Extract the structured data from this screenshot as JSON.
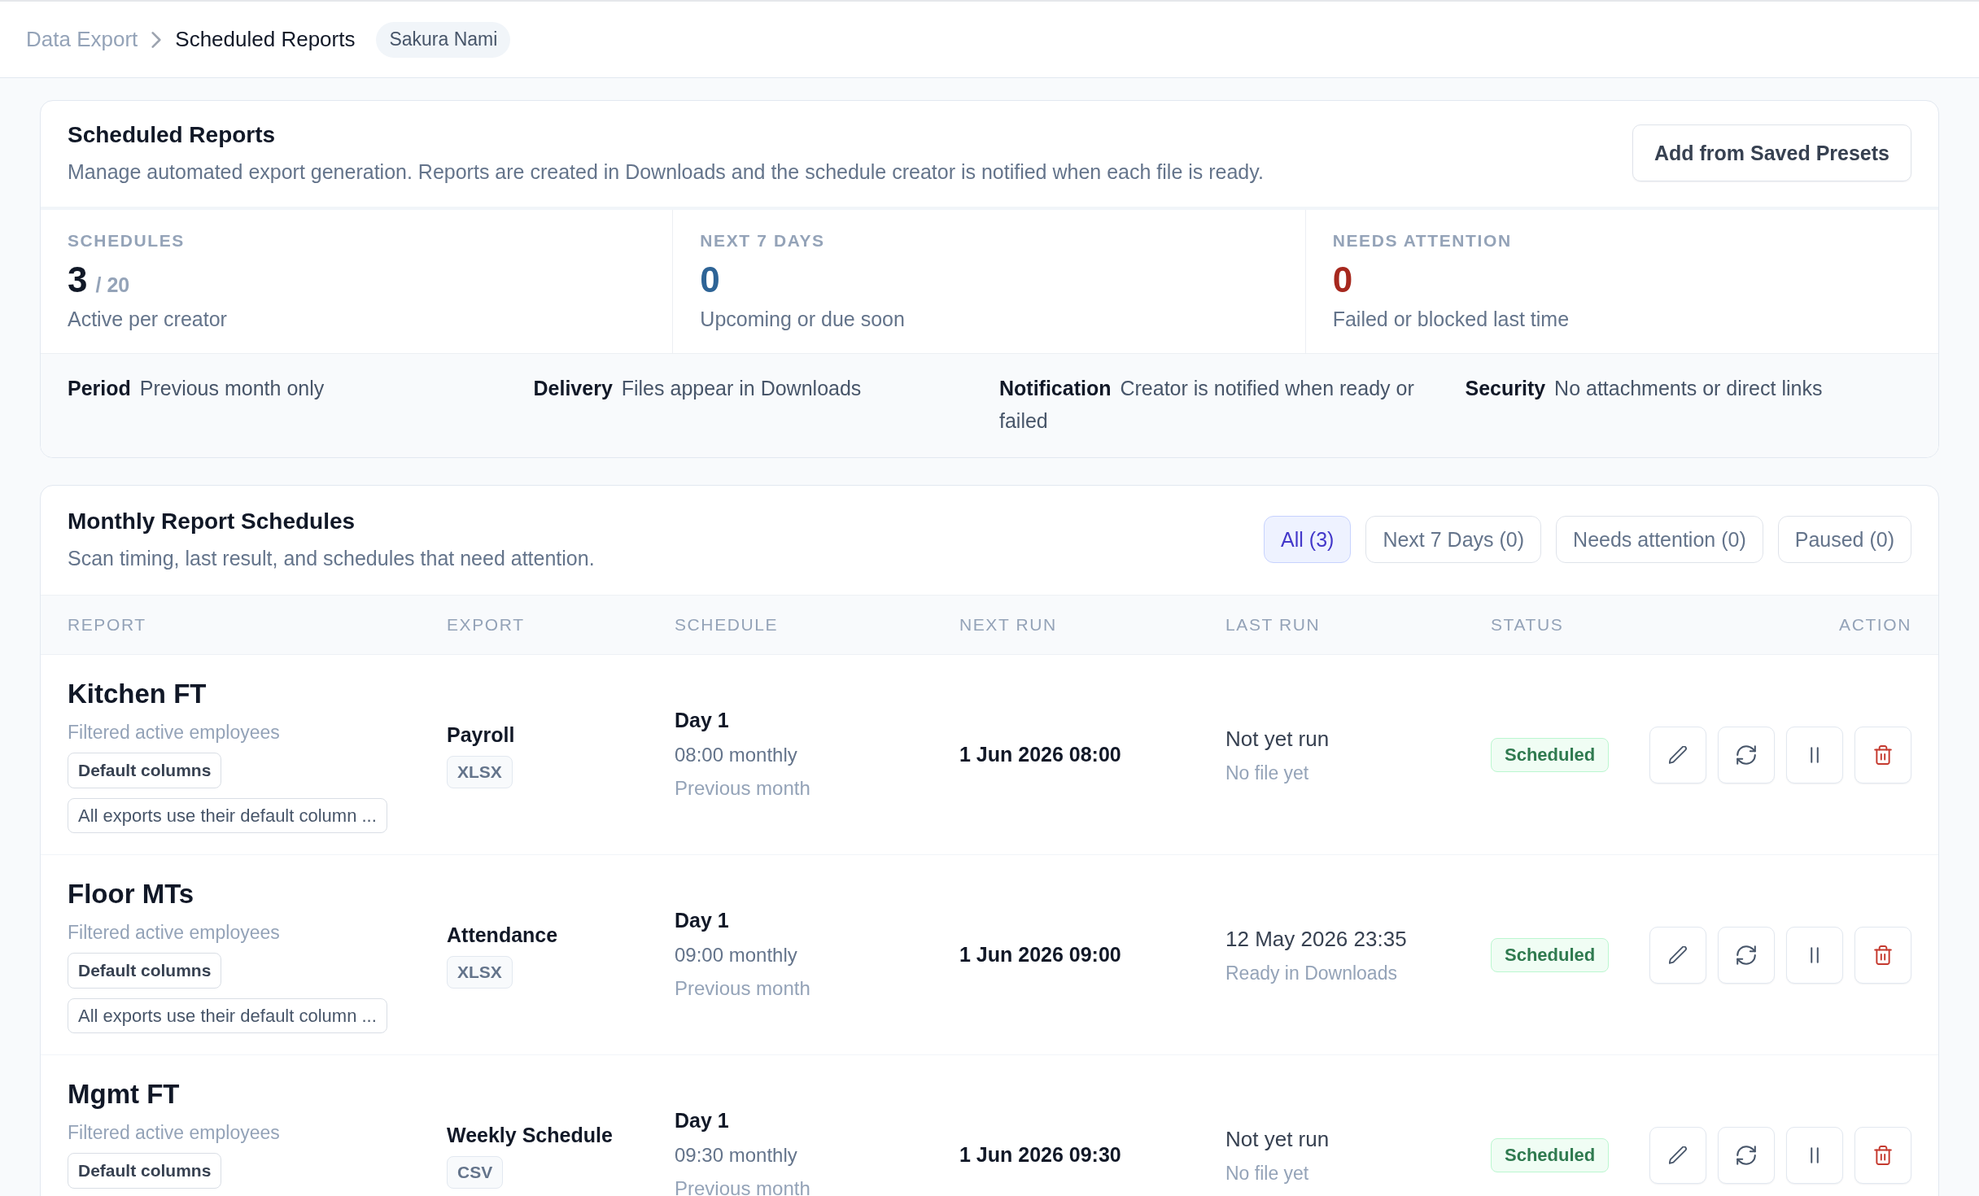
{
  "breadcrumb": [
    {
      "label": "Data Export",
      "current": false
    },
    {
      "label": "Scheduled Reports",
      "current": true
    }
  ],
  "user_chip": "Sakura Nami",
  "summary": {
    "title": "Scheduled Reports",
    "description": "Manage automated export generation. Reports are created in Downloads and the schedule creator is notified when each file is ready.",
    "action": "Add from Saved Presets",
    "stats": [
      {
        "label": "SCHEDULES",
        "value": "3",
        "total": "/ 20",
        "caption": "Active per creator",
        "color": "#111827"
      },
      {
        "label": "NEXT 7 DAYS",
        "value": "0",
        "caption": "Upcoming or due soon",
        "color": "#2e6496"
      },
      {
        "label": "NEEDS ATTENTION",
        "value": "0",
        "caption": "Failed or blocked last time",
        "color": "#a6281e"
      }
    ],
    "policies": [
      {
        "label": "Period",
        "text": "Previous month only"
      },
      {
        "label": "Delivery",
        "text": "Files appear in Downloads"
      },
      {
        "label": "Notification",
        "text": "Creator is notified when ready or failed"
      },
      {
        "label": "Security",
        "text": "No attachments or direct links"
      }
    ]
  },
  "schedules": {
    "title": "Monthly Report Schedules",
    "description": "Scan timing, last result, and schedules that need attention.",
    "filters": [
      {
        "label": "All (3)",
        "selected": true
      },
      {
        "label": "Next 7 Days (0)",
        "selected": false
      },
      {
        "label": "Needs attention (0)",
        "selected": false
      },
      {
        "label": "Paused (0)",
        "selected": false
      }
    ],
    "table": {
      "columns": [
        "REPORT",
        "EXPORT",
        "SCHEDULE",
        "NEXT RUN",
        "LAST RUN",
        "STATUS",
        "ACTION"
      ],
      "rows": [
        {
          "name": "Kitchen FT",
          "scope": "Filtered active employees",
          "columns_tag": "Default columns",
          "columns_note": "All exports use their default column ...",
          "export": "Payroll",
          "format": "XLSX",
          "day": "Day 1",
          "time": "08:00 monthly",
          "period": "Previous month",
          "next_run": "1 Jun 2026 08:00",
          "last_run": "Not yet run",
          "last_result": "No file yet",
          "status": "Scheduled"
        },
        {
          "name": "Floor MTs",
          "scope": "Filtered active employees",
          "columns_tag": "Default columns",
          "columns_note": "All exports use their default column ...",
          "export": "Attendance",
          "format": "XLSX",
          "day": "Day 1",
          "time": "09:00 monthly",
          "period": "Previous month",
          "next_run": "1 Jun 2026 09:00",
          "last_run": "12 May 2026 23:35",
          "last_result": "Ready in Downloads",
          "status": "Scheduled"
        },
        {
          "name": "Mgmt FT",
          "scope": "Filtered active employees",
          "columns_tag": "Default columns",
          "export": "Weekly Schedule",
          "format": "CSV",
          "day": "Day 1",
          "time": "09:30 monthly",
          "period": "Previous month",
          "next_run": "1 Jun 2026 09:30",
          "last_run": "Not yet run",
          "last_result": "No file yet",
          "status": "Scheduled"
        }
      ]
    }
  }
}
